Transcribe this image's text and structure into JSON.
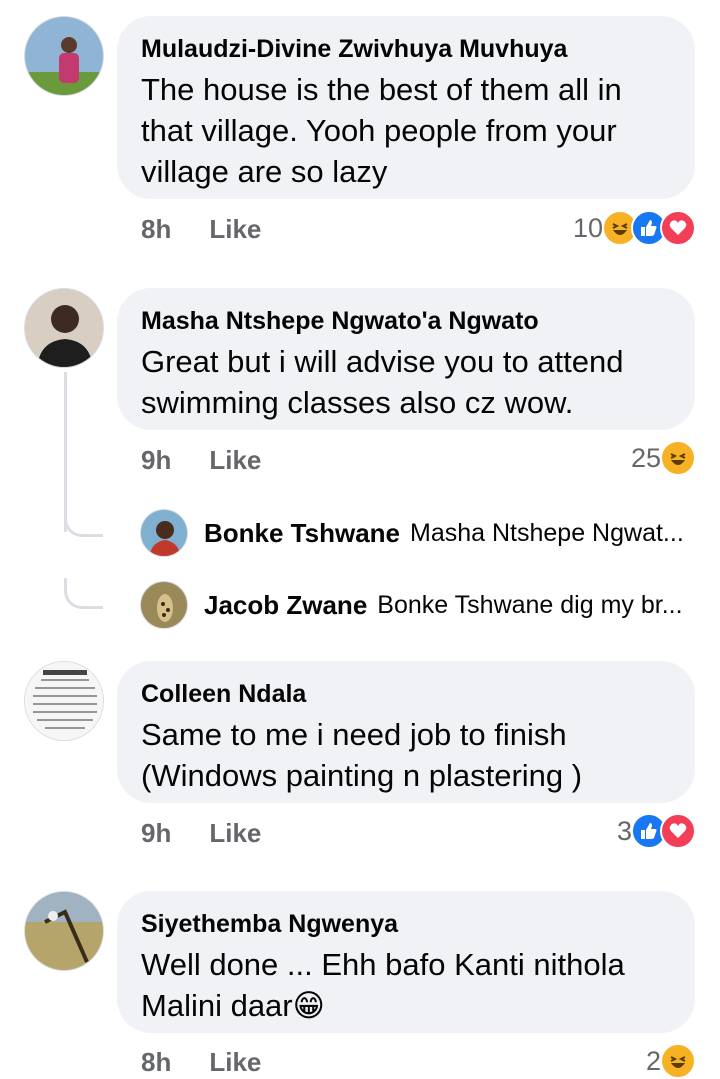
{
  "comments": [
    {
      "author": "Mulaudzi-Divine Zwivhuya Muvhuya",
      "line1": "The house is the best of them all in",
      "line2": "that village. Yooh  people from your",
      "line3": "village are so lazy",
      "time": "8h",
      "like": "Like",
      "reaction_count": "10",
      "reactions": [
        "haha-icon",
        "like-icon",
        "love-icon"
      ]
    },
    {
      "author": "Masha Ntshepe Ngwato'a Ngwato",
      "line1": "Great but i will advise you to attend",
      "line2": "swimming classes also cz wow.",
      "time": "9h",
      "like": "Like",
      "reaction_count": "25",
      "reactions": [
        "haha-icon"
      ],
      "replies": [
        {
          "author": "Bonke Tshwane",
          "text": "Masha Ntshepe Ngwat..."
        },
        {
          "author": "Jacob Zwane",
          "text": "Bonke Tshwane dig my br..."
        }
      ]
    },
    {
      "author": "Colleen Ndala",
      "line1": "Same to me i need  job to finish",
      "line2": "(Windows  painting  n plastering )",
      "time": "9h",
      "like": "Like",
      "reaction_count": "3",
      "reactions": [
        "like-icon",
        "love-icon"
      ]
    },
    {
      "author": "Siyethemba Ngwenya",
      "line1": "Well done ... Ehh bafo Kanti nithola",
      "line2": "Malini daar😁",
      "time": "8h",
      "like": "Like",
      "reaction_count": "2",
      "reactions": [
        "haha-icon"
      ]
    }
  ],
  "colors": {
    "bubble": "#f0f2f5",
    "meta_text": "#65676b",
    "like_blue": "#1877f2",
    "love_red": "#f33e58",
    "haha_yellow": "#f7b125"
  }
}
